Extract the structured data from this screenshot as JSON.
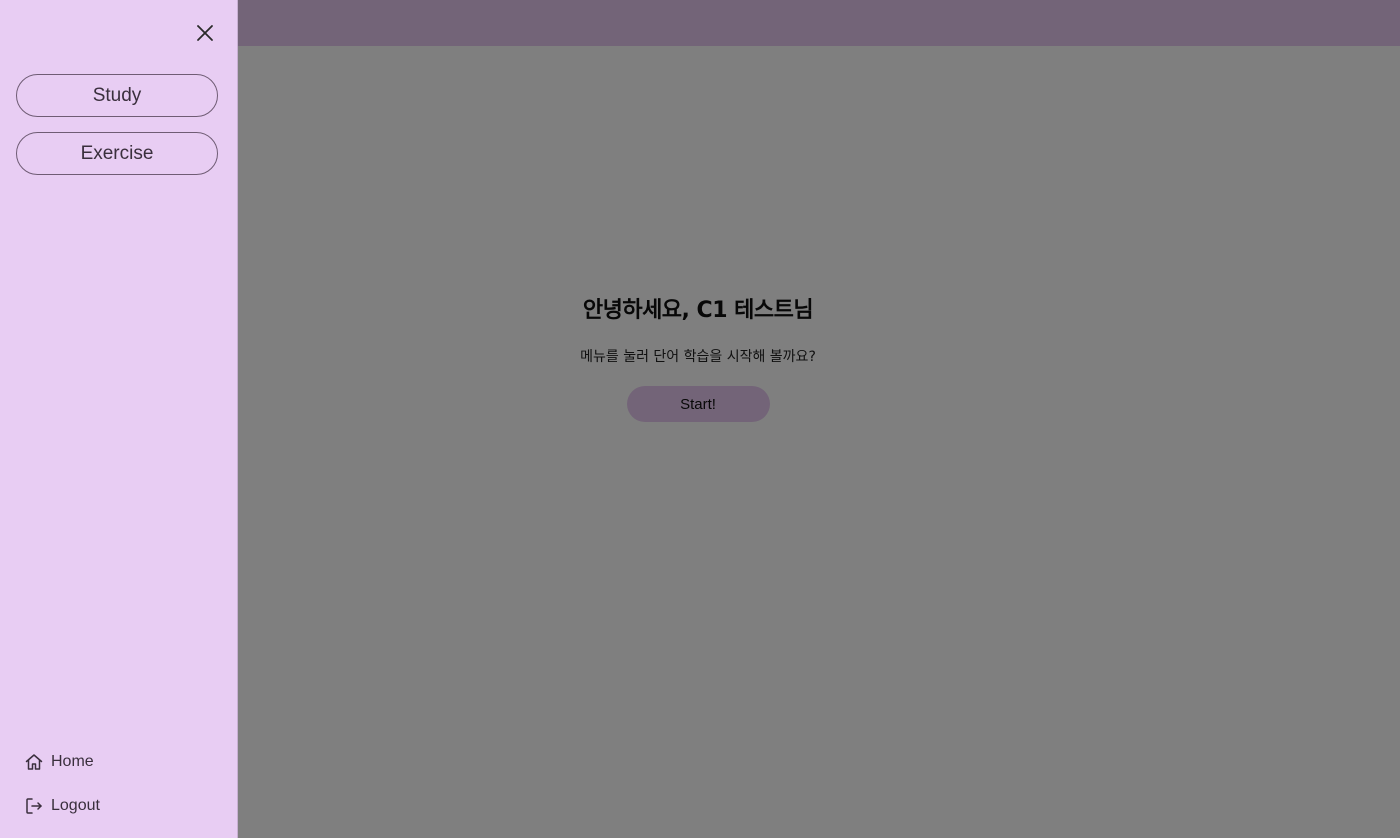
{
  "greeting": {
    "title": "안녕하세요, C1 테스트님",
    "subtitle": "메뉴를 눌러 단어 학습을 시작해 볼까요?",
    "start_label": "Start!"
  },
  "drawer": {
    "menu": [
      {
        "label": "Study"
      },
      {
        "label": "Exercise"
      }
    ],
    "bottom_links": [
      {
        "label": "Home",
        "icon": "home-icon"
      },
      {
        "label": "Logout",
        "icon": "logout-icon"
      }
    ],
    "close_icon": "close-icon"
  },
  "colors": {
    "accent": "#e6c9f0",
    "drawer_bg": "#e8cdf3",
    "overlay": "rgba(0,0,0,0.5)",
    "outline": "#6f5c74"
  }
}
